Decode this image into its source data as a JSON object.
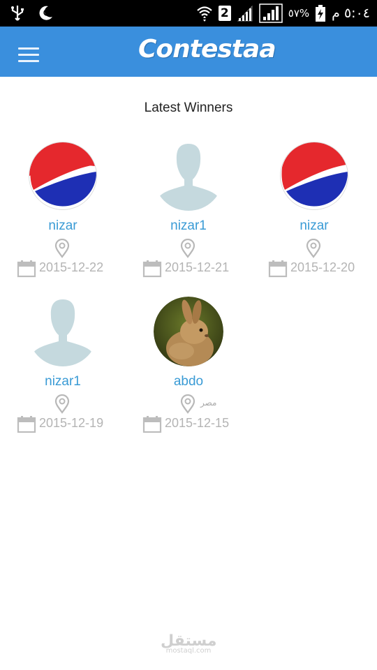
{
  "status_bar": {
    "battery_percent": "٥٧%",
    "clock": "٥:٠٤ م",
    "sim_slot": "2",
    "icons": [
      "usb-icon",
      "moon-icon",
      "wifi-icon",
      "sim-icon",
      "signal-icon",
      "signal-icon",
      "battery-icon"
    ]
  },
  "app_bar": {
    "logo_text": "Contestaa",
    "menu_icon": "hamburger-menu-icon",
    "background": "#3a8fdd"
  },
  "section_title": "Latest Winners",
  "winners": [
    {
      "name": "nizar",
      "location": "",
      "date": "2015-12-22",
      "avatar": "pepsi-logo"
    },
    {
      "name": "nizar1",
      "location": "",
      "date": "2015-12-21",
      "avatar": "default-user-silhouette"
    },
    {
      "name": "nizar",
      "location": "",
      "date": "2015-12-20",
      "avatar": "pepsi-logo"
    },
    {
      "name": "nizar1",
      "location": "",
      "date": "2015-12-19",
      "avatar": "default-user-silhouette"
    },
    {
      "name": "abdo",
      "location": "مصر",
      "date": "2015-12-15",
      "avatar": "rabbit-photo"
    }
  ],
  "watermark": {
    "arabic": "مستقل",
    "latin": "mostaql.com"
  }
}
